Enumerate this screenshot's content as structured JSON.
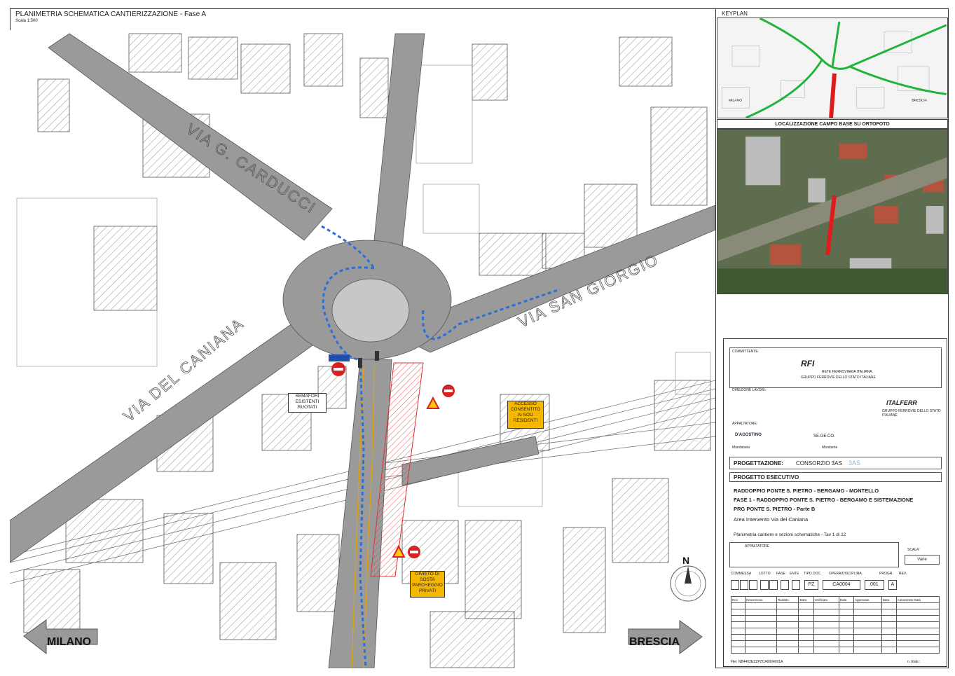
{
  "header": {
    "title": "PLANIMETRIA SCHEMATICA CANTIERIZZAZIONE - Fase A",
    "scale": "Scala 1:500"
  },
  "map": {
    "streets": [
      "VIA G. CARDUCCI",
      "VIA SAN GIORGIO",
      "VIA DEL CANIANA"
    ],
    "directions": {
      "left": "MILANO",
      "right": "BRESCIA"
    },
    "north": "N",
    "signs": {
      "traffic_lights": "SEMAFORI ESISTENTI RUOTATI",
      "access": "ACCESSO CONSENTITO AI SOLI RESIDENTI",
      "no_parking": "DIVIETO DI SOSTA PARCHEGGIO PRIVATI"
    }
  },
  "keyplan": {
    "label": "KEYPLAN",
    "places": [
      "MILANO",
      "BRESCIA"
    ]
  },
  "ortho": {
    "title": "LOCALIZZAZIONE CAMPO BASE SU ORTOFOTO"
  },
  "cartouche": {
    "committente_label": "COMMITTENTE:",
    "rfi": "RFI",
    "rfi_sub": "RETE FERROVIARIA ITALIANA",
    "rfi_sub2": "GRUPPO FERROVIE DELLO STATO ITALIANE",
    "direzione_label": "DIREZIONE LAVORI:",
    "italferr": "ITALFERR",
    "italferr_sub": "GRUPPO FERROVIE DELLO STATO ITALIANE",
    "appaltatore_label": "APPALTATORE:",
    "dagostino": "D'AGOSTINO",
    "mandataria": "Mandataria",
    "segeco": "SE.GE.CO.",
    "mandante": "Mandante",
    "progettazione_label": "PROGETTAZIONE:",
    "progettazione_value": "CONSORZIO 3AS",
    "progettazione_logo": "3AS",
    "progetto": "PROGETTO ESECUTIVO",
    "line1": "RADDOPPIO PONTE S. PIETRO - BERGAMO - MONTELLO",
    "line2": "FASE 1 - RADDOPPIO PONTE S. PIETRO - BERGAMO E SISTEMAZIONE",
    "line3": "PRG PONTE S. PIETRO - Parte B",
    "area": "Area Intervento Via del Caniana",
    "tav": "Planimetria cantiere e sezioni schematiche - Tav 1 di 12",
    "appaltatore_small": "APPALTATORE",
    "scala_label": "SCALA:",
    "scala_value": "Varie",
    "codes_labels": [
      "COMMESSA",
      "LOTTO",
      "FASE",
      "ENTE",
      "TIPO DOC.",
      "OPERA/DISCIPLINA",
      "PROGR.",
      "REV."
    ],
    "codes": {
      "tipo": "PZ",
      "opera": "CA0004",
      "progr": "001",
      "rev": "A"
    },
    "rev_headers": [
      "Rev.",
      "Descrizione",
      "Redatto",
      "Data",
      "Verificato",
      "Data",
      "Approvato",
      "Data",
      "Autorizzato Data"
    ],
    "file": "File: NB4402EZZPZCA0004001A",
    "elab": "n. Elab.:"
  }
}
